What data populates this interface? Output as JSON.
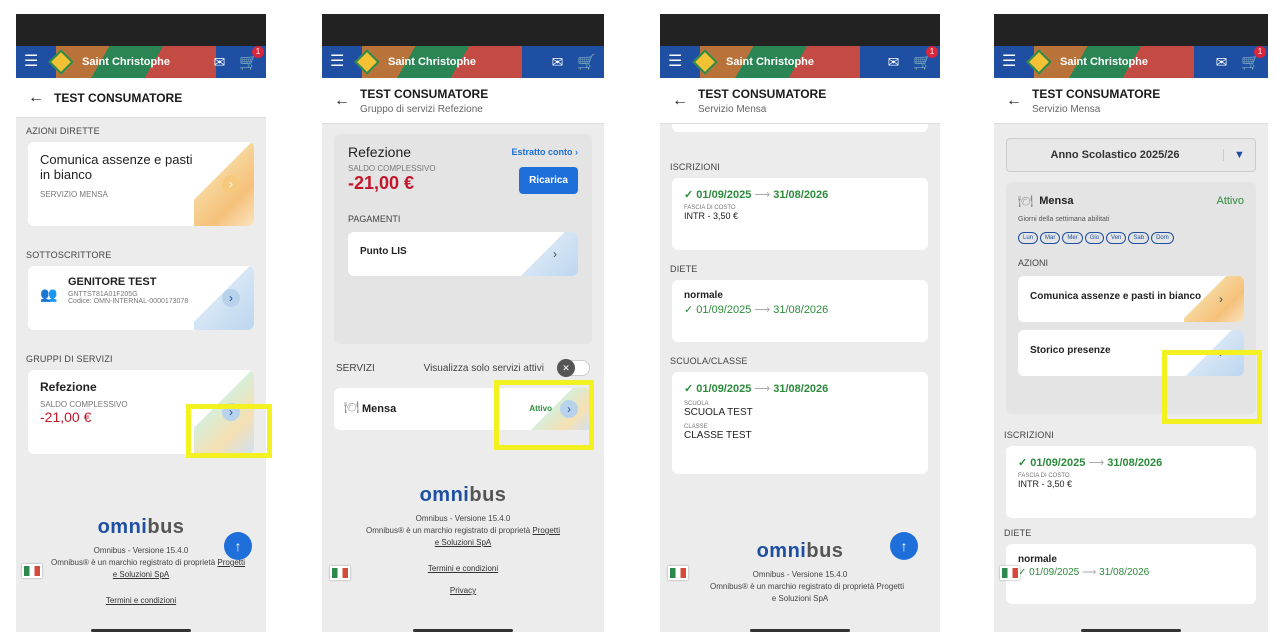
{
  "app": {
    "title": "Saint Christophe",
    "cart_badge": "1"
  },
  "colors": {
    "primary": "#1e4fa3",
    "negative": "#c4162a",
    "active_green": "#2c8a3b",
    "highlight": "#f4f120"
  },
  "screen1": {
    "header_title": "TEST CONSUMATORE",
    "sec_azioni": "AZIONI DIRETTE",
    "azioni_title": "Comunica assenze e pasti in bianco",
    "azioni_sub": "SERVIZIO MENSA",
    "sec_sottoscrittore": "SOTTOSCRITTORE",
    "parent_name": "GENITORE TEST",
    "parent_cf": "GNTTST81A01F205G",
    "parent_code": "Codice: OMN-INTERNAL-0000173078",
    "sec_gruppi": "GRUPPI DI SERVIZI",
    "group_title": "Refezione",
    "group_saldo_label": "SALDO COMPLESSIVO",
    "group_saldo": "-21,00 €"
  },
  "screen2": {
    "header_title": "TEST CONSUMATORE",
    "header_sub": "Gruppo di servizi Refezione",
    "ref_title": "Refezione",
    "estratto": "Estratto conto ›",
    "saldo_label": "SALDO COMPLESSIVO",
    "saldo": "-21,00 €",
    "ricarica": "Ricarica",
    "pagamenti": "PAGAMENTI",
    "punto_lis": "Punto LIS",
    "servizi": "SERVIZI",
    "toggle_label": "Visualizza solo servizi attivi",
    "mensa": "Mensa",
    "attivo": "Attivo"
  },
  "screen3": {
    "header_title": "TEST CONSUMATORE",
    "header_sub": "Servizio Mensa",
    "iscrizioni": "ISCRIZIONI",
    "isc_from": "01/09/2025",
    "isc_to": "31/08/2026",
    "fascia_label": "FASCIA DI COSTO",
    "fascia_value": "INTR - 3,50 €",
    "diete": "DIETE",
    "diet_name": "normale",
    "diet_from": "01/09/2025",
    "diet_to": "31/08/2026",
    "scuola_classe": "SCUOLA/CLASSE",
    "sc_from": "01/09/2025",
    "sc_to": "31/08/2026",
    "scuola_label": "SCUOLA",
    "scuola_value": "SCUOLA TEST",
    "classe_label": "CLASSE",
    "classe_value": "CLASSE TEST"
  },
  "screen4": {
    "header_title": "TEST CONSUMATORE",
    "header_sub": "Servizio Mensa",
    "anno": "Anno Scolastico 2025/26",
    "mensa": "Mensa",
    "attivo": "Attivo",
    "giorni_label": "Giorni della settimana abilitati",
    "days": [
      "Lun",
      "Mar",
      "Mer",
      "Gio",
      "Ven",
      "Sab",
      "Dom"
    ],
    "azioni": "AZIONI",
    "comunica": "Comunica assenze e pasti in bianco",
    "storico": "Storico presenze",
    "iscrizioni": "ISCRIZIONI",
    "isc_from": "01/09/2025",
    "isc_to": "31/08/2026",
    "fascia_label": "FASCIA DI COSTO",
    "fascia_value": "INTR - 3,50 €",
    "diete": "DIETE",
    "diet_name": "normale",
    "diet_from": "01/09/2025",
    "diet_to": "31/08/2026"
  },
  "footer": {
    "brand_a": "omni",
    "brand_b": "bus",
    "version": "Omnibus - Versione 15.4.0",
    "trademark": "Omnibus® è un marchio registrato di proprietà",
    "trademark_link1": "Progetti",
    "trademark_link2": "e Soluzioni SpA",
    "trademark_plain": "Progetti e Soluzioni SpA",
    "terms": "Termini e condizioni",
    "privacy": "Privacy"
  },
  "arrow": "→"
}
